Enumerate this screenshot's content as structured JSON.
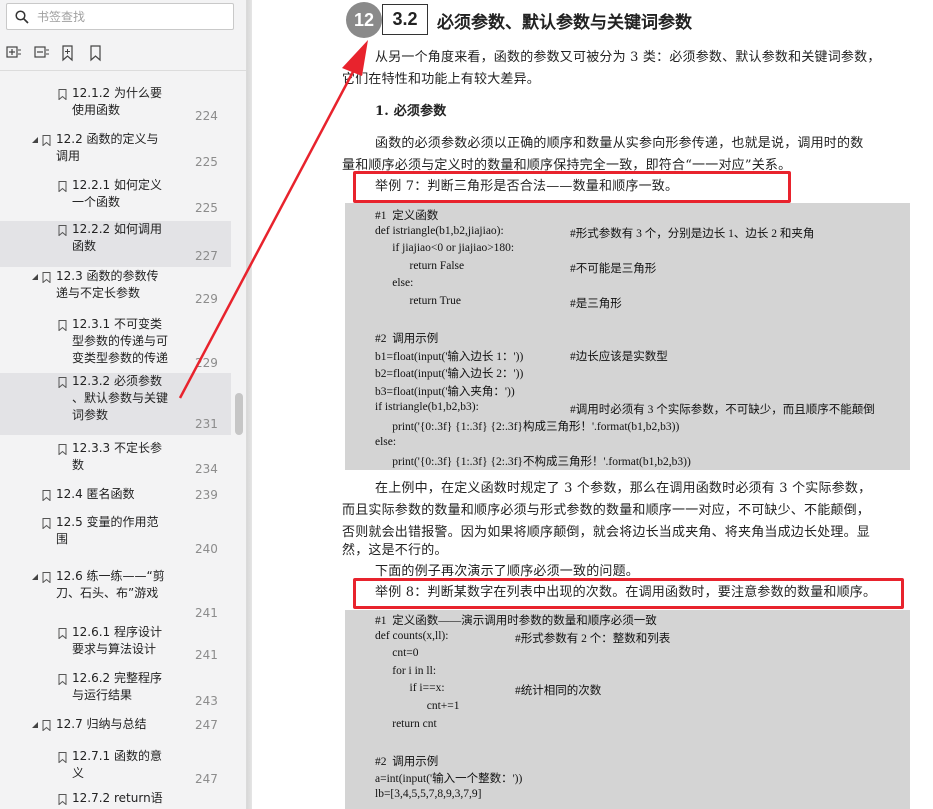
{
  "sidebar": {
    "search_placeholder": "书签查找",
    "tools": [
      "expand-all-icon",
      "collapse-all-icon",
      "add-bookmark-icon",
      "bookmark-icon"
    ],
    "items": [
      {
        "level": 2,
        "label": "12.1.2  为什么要\n使用函数",
        "page": "224",
        "expandable": false,
        "selected": false
      },
      {
        "level": 1,
        "label": "12.2  函数的定义与\n调用",
        "page": "225",
        "expandable": true,
        "selected": false
      },
      {
        "level": 2,
        "label": "12.2.1  如何定义\n一个函数",
        "page": "225",
        "expandable": false,
        "selected": false
      },
      {
        "level": 2,
        "label": "12.2.2  如何调用\n函数",
        "page": "227",
        "expandable": false,
        "selected": true
      },
      {
        "level": 1,
        "label": "12.3  函数的参数传\n递与不定长参数",
        "page": "229",
        "expandable": true,
        "selected": false
      },
      {
        "level": 2,
        "label": "12.3.1  不可变类\n型参数的传递与可\n变类型参数的传递",
        "page": "229",
        "expandable": false,
        "selected": false
      },
      {
        "level": 2,
        "label": "12.3.2  必须参数\n、默认参数与关键\n词参数",
        "page": "231",
        "expandable": false,
        "selected": true
      },
      {
        "level": 2,
        "label": "12.3.3  不定长参\n数",
        "page": "234",
        "expandable": false,
        "selected": false
      },
      {
        "level": 1,
        "label": "12.4  匿名函数",
        "page": "239",
        "expandable": false,
        "selected": false
      },
      {
        "level": 1,
        "label": "12.5  变量的作用范\n围",
        "page": "240",
        "expandable": false,
        "selected": false
      },
      {
        "level": 1,
        "label": "12.6  练一练——“剪\n刀、石头、布”游戏",
        "page": "241",
        "expandable": true,
        "selected": false
      },
      {
        "level": 2,
        "label": "12.6.1  程序设计\n要求与算法设计",
        "page": "241",
        "expandable": false,
        "selected": false
      },
      {
        "level": 2,
        "label": "12.6.2  完整程序\n与运行结果",
        "page": "243",
        "expandable": false,
        "selected": false
      },
      {
        "level": 1,
        "label": "12.7  归纳与总结",
        "page": "247",
        "expandable": true,
        "selected": false
      },
      {
        "level": 2,
        "label": "12.7.1  函数的意\n义",
        "page": "247",
        "expandable": false,
        "selected": false
      },
      {
        "level": 2,
        "label": "12.7.2  return语",
        "page": "",
        "expandable": false,
        "selected": false
      }
    ]
  },
  "document": {
    "chapter_badge": "12",
    "section_number": "3.2",
    "section_title": "必须参数、默认参数与关键词参数",
    "intro_line1": "从另一个角度来看，函数的参数又可被分为 3 类：必须参数、默认参数和关键词参数，",
    "intro_line2": "它们在特性和功能上有较大差异。",
    "subheading": "1.  必须参数",
    "p1_line1": "函数的必须参数必须以正确的顺序和数量从实参向形参传递，也就是说，调用时的数",
    "p1_line2": "量和顺序必须与定义时的数量和顺序保持完全一致，即符合“一一对应”关系。",
    "example7": "举例 7：判断三角形是否合法——数量和顺序一致。",
    "code1": [
      "#1  定义函数",
      "def istriangle(b1,b2,jiajiao):",
      "      if jiajiao<0 or jiajiao>180:",
      "            return False",
      "      else:",
      "            return True",
      "",
      "#2  调用示例",
      "b1=float(input('输入边长 1：'))",
      "b2=float(input('输入边长 2：'))",
      "b3=float(input('输入夹角：'))",
      "if istriangle(b1,b2,b3):",
      "      print('{0:.3f} {1:.3f} {2:.3f}构成三角形！'.format(b1,b2,b3))",
      "else:",
      "      print('{0:.3f} {1:.3f} {2:.3f}不构成三角形！'.format(b1,b2,b3))"
    ],
    "code1_comments": [
      {
        "line": 1,
        "text": "#形式参数有 3 个，分别是边长 1、边长 2 和夹角"
      },
      {
        "line": 3,
        "text": "#不可能是三角形"
      },
      {
        "line": 5,
        "text": "#是三角形"
      },
      {
        "line": 8,
        "text": "#边长应该是实数型"
      },
      {
        "line": 11,
        "text": "#调用时必须有 3 个实际参数，不可缺少，而且顺序不能颠倒"
      }
    ],
    "p2_line1": "在上例中，在定义函数时规定了 3 个参数，那么在调用函数时必须有 3 个实际参数，",
    "p2_line2": "而且实际参数的数量和顺序必须与形式参数的数量和顺序一一对应，不可缺少、不能颠倒，",
    "p2_line3": "否则就会出错报警。因为如果将顺序颠倒，就会将边长当成夹角、将夹角当成边长处理。显",
    "p2_line4": "然，这是不行的。",
    "p3": "下面的例子再次演示了顺序必须一致的问题。",
    "example8": "举例 8：判断某数字在列表中出现的次数。在调用函数时，要注意参数的数量和顺序。",
    "code2": [
      "#1  定义函数——演示调用时参数的数量和顺序必须一致",
      "def counts(x,ll):",
      "      cnt=0",
      "      for i in ll:",
      "            if i==x:",
      "                  cnt+=1",
      "      return cnt",
      "",
      "#2  调用示例",
      "a=int(input('输入一个整数：'))",
      "lb=[3,4,5,5,7,8,9,3,7,9]"
    ],
    "code2_comments": [
      {
        "line": 1,
        "text": "#形式参数有 2 个：整数和列表"
      },
      {
        "line": 4,
        "text": "#统计相同的次数"
      }
    ]
  },
  "colors": {
    "highlight": "#e8232d",
    "code_bg": "#d4d4d4",
    "sidebar_bg": "#f3f3f4",
    "selected_bg": "#e3e3e6"
  }
}
